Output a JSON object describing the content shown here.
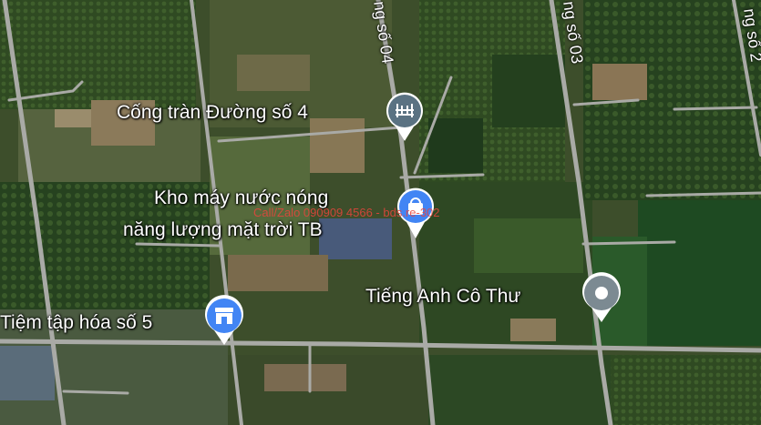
{
  "places": [
    {
      "id": "cong-tran",
      "label": "Cống tràn Đường số 4",
      "icon": "bridge-icon",
      "color": "#5a7282"
    },
    {
      "id": "kho-may",
      "label_line1": "Kho máy nước nóng",
      "label_line2": "năng lượng mặt trời TB",
      "icon": "shopping-bag-icon",
      "color": "#4285f4"
    },
    {
      "id": "tieng-anh",
      "label": "Tiếng Anh Cô Thư",
      "icon": "place-icon",
      "color": "#7c8a92"
    },
    {
      "id": "tiem-tap-hoa",
      "label": "Tiệm tập hóa số 5",
      "icon": "store-icon",
      "color": "#4285f4"
    }
  ],
  "roads": [
    {
      "id": "duong-so-04",
      "label": "ng số 04"
    },
    {
      "id": "duong-so-03",
      "label": "ng số 03"
    },
    {
      "id": "duong-so-2",
      "label": "ng số 2"
    }
  ],
  "watermark": "Call/Zalo 090909 4566 - bds.re-302",
  "colors": {
    "road": "#a9aaa6",
    "shop_pin": "#4285f4",
    "bridge_pin": "#5a7282",
    "generic_pin": "#7c8a92",
    "watermark": "#e8453c"
  }
}
